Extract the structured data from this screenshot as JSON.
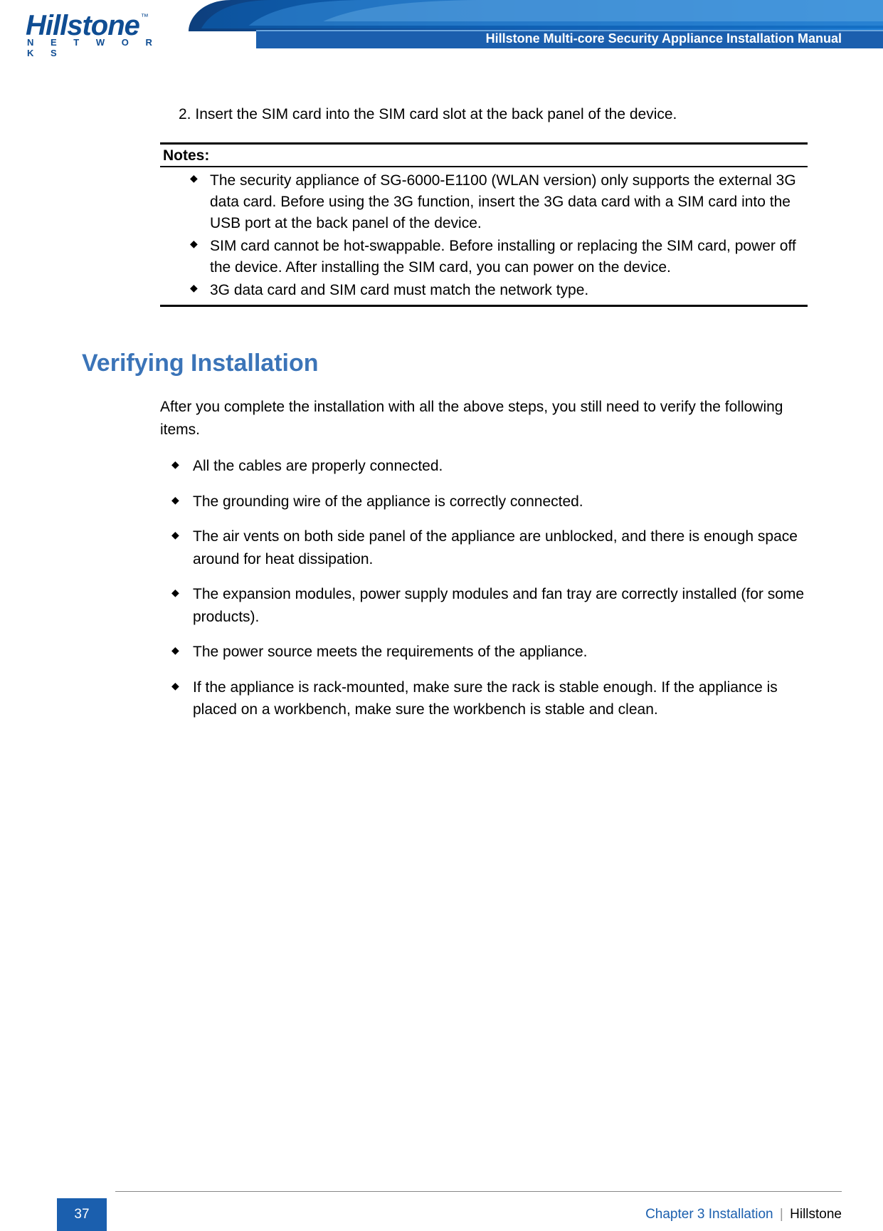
{
  "header": {
    "title": "Hillstone Multi-core Security Appliance Installation Manual",
    "logo_main": "Hillstone",
    "logo_tm": "™",
    "logo_sub": "N E T W O R K S"
  },
  "step": {
    "number": "2.",
    "text": "Insert the SIM card into the SIM card slot at the back panel of the device."
  },
  "notes": {
    "heading": "Notes:",
    "items": [
      "The security appliance of SG-6000-E1100 (WLAN version) only supports the external 3G data card. Before using the 3G function, insert the 3G data card with a SIM card into the USB port at the back panel of the device.",
      "SIM card cannot be hot-swappable. Before installing or replacing the SIM card, power off the device. After installing the SIM card, you can power on the device.",
      "3G data card and SIM card must match the network type."
    ]
  },
  "section": {
    "heading": "Verifying Installation",
    "intro": "After you complete the installation with all the above steps, you still need to verify the following items.",
    "items": [
      "All the cables are properly connected.",
      "The grounding wire of the appliance is correctly connected.",
      "The air vents on both side panel of the appliance are unblocked, and there is enough space around for heat dissipation.",
      "The expansion modules, power supply modules and fan tray are correctly installed (for some products).",
      "The power source meets the requirements of the appliance.",
      "If the appliance is rack-mounted, make sure the rack is stable enough. If the appliance is placed on a workbench, make sure the workbench is stable and clean."
    ]
  },
  "footer": {
    "page": "37",
    "chapter": "Chapter 3 Installation",
    "brand": "Hillstone"
  }
}
